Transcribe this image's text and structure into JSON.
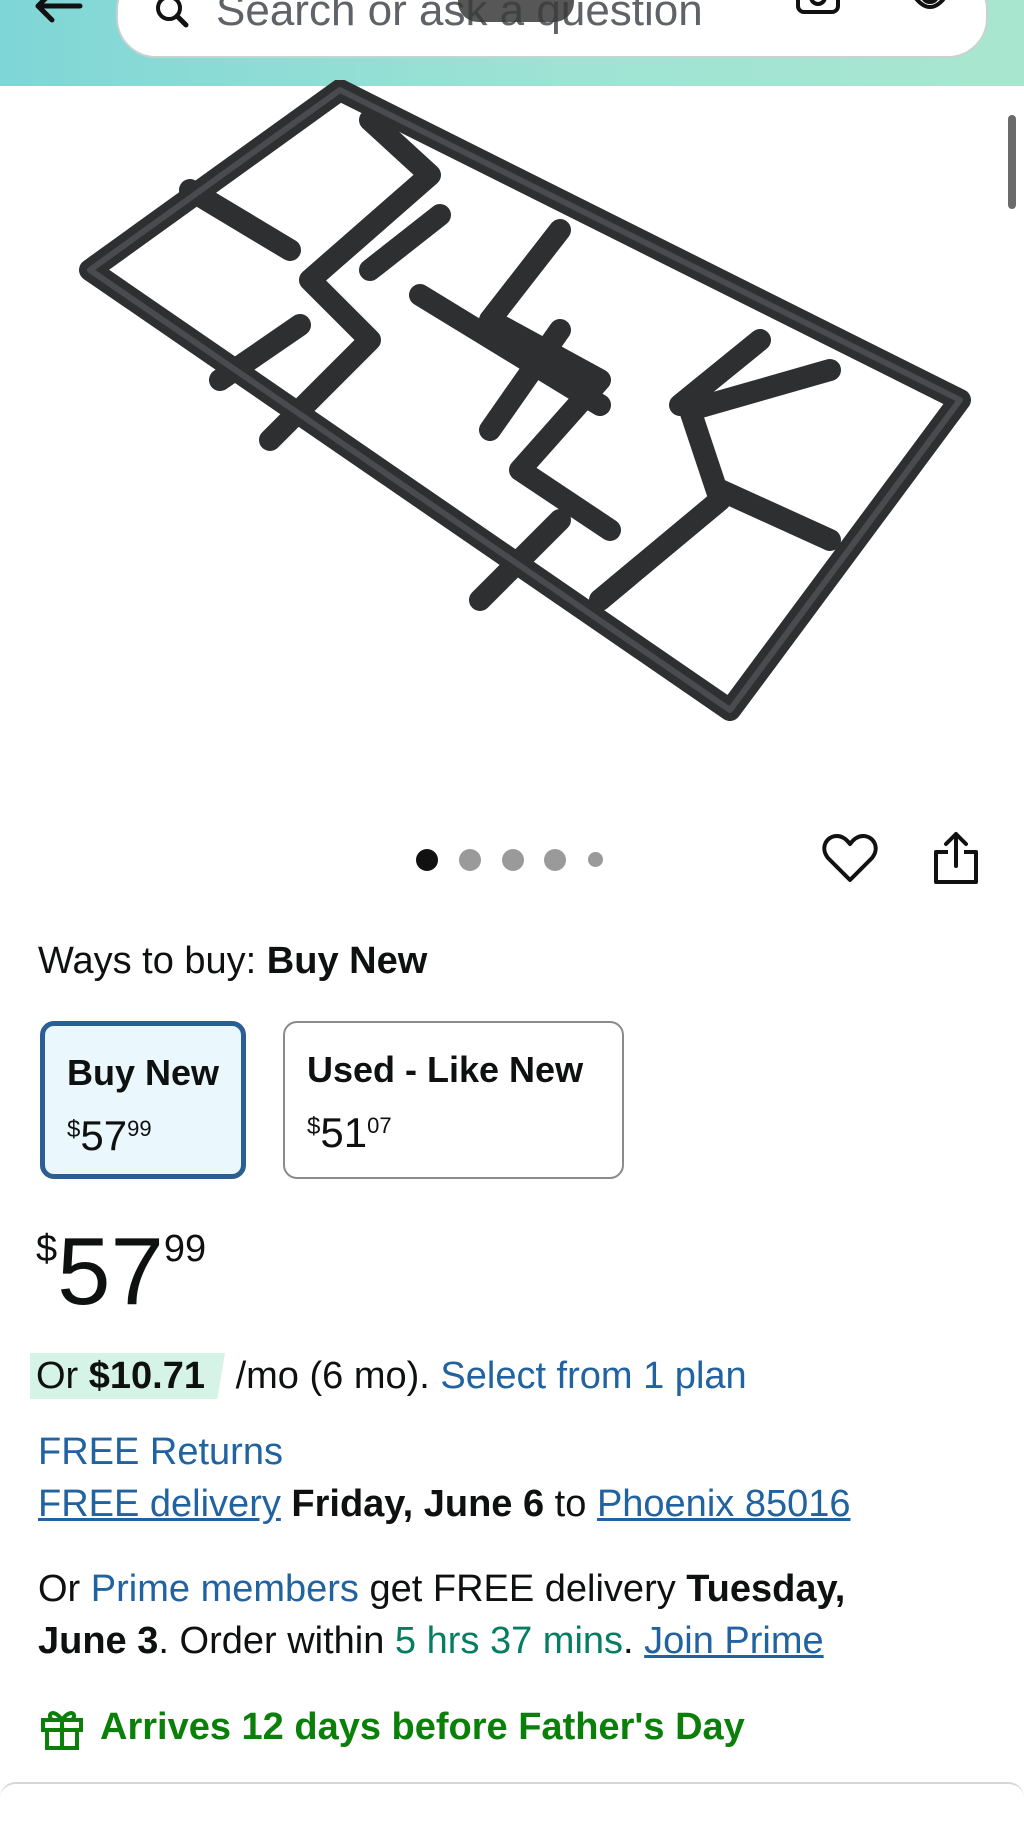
{
  "search": {
    "placeholder": "Search or ask a question"
  },
  "gallery": {
    "image_count": 5,
    "active_index": 0
  },
  "ways_to_buy": {
    "prefix": "Ways to buy:",
    "selected": "Buy New"
  },
  "options": [
    {
      "title": "Buy New",
      "symbol": "$",
      "whole": "57",
      "fraction": "99",
      "selected": true
    },
    {
      "title": "Used - Like New",
      "symbol": "$",
      "whole": "51",
      "fraction": "07",
      "selected": false
    }
  ],
  "price": {
    "symbol": "$",
    "whole": "57",
    "fraction": "99"
  },
  "installment": {
    "prefix": "Or ",
    "amount": "$10.71",
    "term": " /mo (6 mo). ",
    "plan_link": "Select from 1 plan"
  },
  "returns": "FREE Returns",
  "delivery": {
    "free_delivery_link": "FREE delivery",
    "date": " Friday, June 6",
    "to": " to ",
    "location": "Phoenix 85016"
  },
  "prime": {
    "or": "Or ",
    "members_link": "Prime members",
    "get": " get FREE delivery ",
    "date_part1": "Tuesday,",
    "date_part2": "June 3",
    "order_within": ". Order within ",
    "countdown": "5 hrs 37 mins",
    "period": ". ",
    "join_link": "Join Prime"
  },
  "gift_message": "Arrives 12 days before Father's Day",
  "colors": {
    "link": "#2162a1",
    "selected_border": "#2b5f94",
    "teal": "#067d62",
    "green": "#0a7f0a"
  }
}
